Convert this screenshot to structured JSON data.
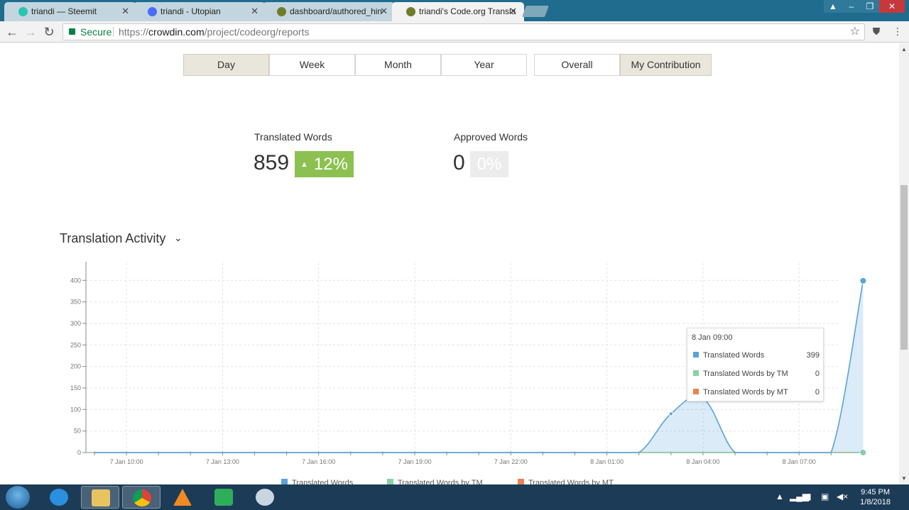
{
  "browser": {
    "tabs": [
      {
        "title": "triandi — Steemit",
        "active": false,
        "color": "#26c6b0"
      },
      {
        "title": "triandi - Utopian",
        "active": false,
        "color": "#4a6cf7"
      },
      {
        "title": "dashboard/authored_hin",
        "active": false,
        "color": "#6f7d2a"
      },
      {
        "title": "triandi's Code.org Transla",
        "active": true,
        "color": "#6f7d2a"
      }
    ],
    "address": {
      "secure_label": "Secure",
      "url_prefix": "https://",
      "url_host": "crowdin.com",
      "url_path": "/project/codeorg/reports"
    }
  },
  "period_tabs": [
    {
      "label": "Day",
      "selected": true
    },
    {
      "label": "Week",
      "selected": false
    },
    {
      "label": "Month",
      "selected": false
    },
    {
      "label": "Year",
      "selected": false
    }
  ],
  "scope_tabs": [
    {
      "label": "Overall",
      "selected": false
    },
    {
      "label": "My Contribution",
      "selected": true
    }
  ],
  "metrics": {
    "translated": {
      "label": "Translated Words",
      "value": "859",
      "change": "12%",
      "arrow": "▲"
    },
    "approved": {
      "label": "Approved Words",
      "value": "0",
      "change": "0%"
    }
  },
  "activity": {
    "title": "Translation Activity"
  },
  "chart_data": {
    "type": "area",
    "x": [
      "7 Jan 09:00",
      "7 Jan 10:00",
      "7 Jan 11:00",
      "7 Jan 12:00",
      "7 Jan 13:00",
      "7 Jan 14:00",
      "7 Jan 15:00",
      "7 Jan 16:00",
      "7 Jan 17:00",
      "7 Jan 18:00",
      "7 Jan 19:00",
      "7 Jan 20:00",
      "7 Jan 21:00",
      "7 Jan 22:00",
      "7 Jan 23:00",
      "8 Jan 00:00",
      "8 Jan 01:00",
      "8 Jan 02:00",
      "8 Jan 03:00",
      "8 Jan 04:00",
      "8 Jan 05:00",
      "8 Jan 06:00",
      "8 Jan 07:00",
      "8 Jan 08:00",
      "8 Jan 09:00"
    ],
    "tick_labels": [
      "7 Jan 10:00",
      "7 Jan 13:00",
      "7 Jan 16:00",
      "7 Jan 19:00",
      "7 Jan 22:00",
      "8 Jan 01:00",
      "8 Jan 04:00",
      "8 Jan 07:00"
    ],
    "series": [
      {
        "name": "Translated Words",
        "color": "#5aa3d9",
        "values": [
          0,
          0,
          0,
          0,
          0,
          0,
          0,
          0,
          0,
          0,
          0,
          0,
          0,
          0,
          0,
          0,
          0,
          0,
          90,
          126,
          0,
          0,
          0,
          0,
          399
        ]
      },
      {
        "name": "Translated Words by TM",
        "color": "#8cd1a3",
        "values": [
          0,
          0,
          0,
          0,
          0,
          0,
          0,
          0,
          0,
          0,
          0,
          0,
          0,
          0,
          0,
          0,
          0,
          0,
          0,
          0,
          0,
          0,
          0,
          0,
          0
        ]
      },
      {
        "name": "Translated Words by MT",
        "color": "#e9834f",
        "values": [
          0,
          0,
          0,
          0,
          0,
          0,
          0,
          0,
          0,
          0,
          0,
          0,
          0,
          0,
          0,
          0,
          0,
          0,
          0,
          0,
          0,
          0,
          0,
          0,
          0
        ]
      }
    ],
    "y_ticks": [
      0,
      50,
      100,
      150,
      200,
      250,
      300,
      350,
      400
    ],
    "ylim": [
      0,
      440
    ],
    "grid": true,
    "legend": "bottom"
  },
  "tooltip": {
    "title": "8 Jan 09:00",
    "rows": [
      {
        "label": "Translated Words",
        "value": "399",
        "color": "#5aa3d9"
      },
      {
        "label": "Translated Words by TM",
        "value": "0",
        "color": "#8cd1a3"
      },
      {
        "label": "Translated Words by MT",
        "value": "0",
        "color": "#e9834f"
      }
    ]
  },
  "taskbar": {
    "time": "9:45 PM",
    "date": "1/8/2018"
  }
}
